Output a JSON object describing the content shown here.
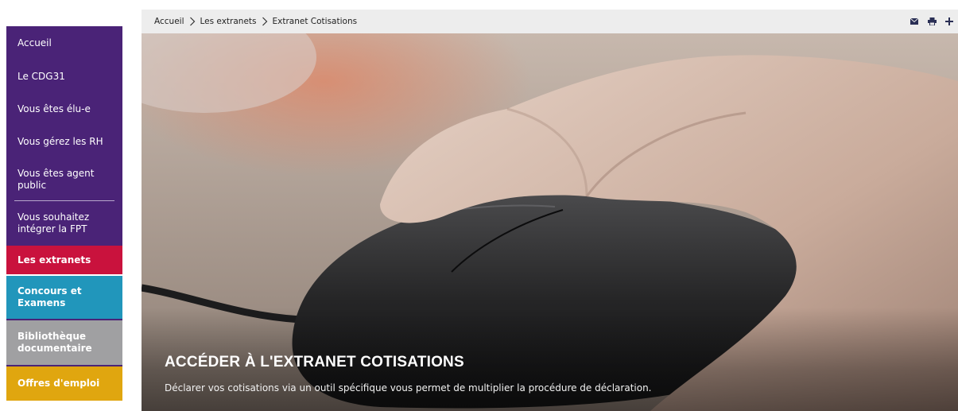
{
  "sidebar": {
    "items": [
      {
        "label": "Accueil",
        "color": "#4a2377"
      },
      {
        "label": "Le CDG31",
        "color": "#4a2377"
      },
      {
        "label": "Vous êtes élu-e",
        "color": "#4a2377"
      },
      {
        "label": "Vous gérez les RH",
        "color": "#4a2377"
      },
      {
        "label": "Vous êtes agent public",
        "color": "#4a2377"
      },
      {
        "label": "Vous souhaitez intégrer la FPT",
        "color": "#4a2377"
      },
      {
        "label": "Les extranets",
        "color": "#c9123d"
      },
      {
        "label": "Concours et Examens",
        "color": "#2196bb"
      },
      {
        "label": "Bibliothèque documentaire",
        "color": "#a0a0a2"
      },
      {
        "label": "Offres d'emploi",
        "color": "#e0a60f"
      }
    ]
  },
  "breadcrumb": {
    "items": [
      "Accueil",
      "Les extranets",
      "Extranet Cotisations"
    ],
    "separator_icon": "chevron-right-icon"
  },
  "tools": {
    "icons": [
      "envelope-icon",
      "printer-icon",
      "plus-icon"
    ]
  },
  "hero": {
    "title": "ACCÉDER À L'EXTRANET COTISATIONS",
    "description": "Déclarer vos cotisations via un outil spécifique vous permet de multiplier la procédure de déclaration.",
    "image": "hand-on-computer-mouse"
  }
}
